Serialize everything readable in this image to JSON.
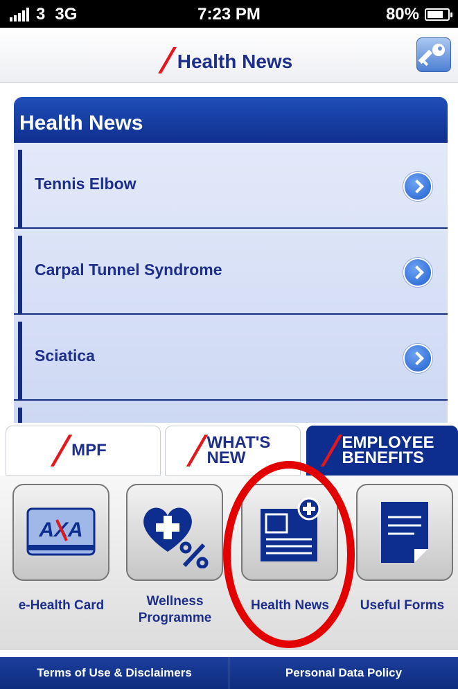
{
  "status_bar": {
    "carrier": "3",
    "network": "3G",
    "time": "7:23 PM",
    "battery": "80%",
    "battery_level": 0.8
  },
  "nav": {
    "title": "Health News"
  },
  "panel": {
    "header": "Health News",
    "items": [
      {
        "label": "Tennis Elbow"
      },
      {
        "label": "Carpal Tunnel Syndrome"
      },
      {
        "label": "Sciatica"
      }
    ]
  },
  "tabs": [
    {
      "label": "MPF"
    },
    {
      "label_line1": "WHAT'S",
      "label_line2": "NEW"
    },
    {
      "label_line1": "EMPLOYEE",
      "label_line2": "BENEFITS"
    }
  ],
  "grid": {
    "items": [
      {
        "label_line1": "e-Health Card",
        "label_line2": ""
      },
      {
        "label_line1": "Wellness",
        "label_line2": "Programme"
      },
      {
        "label_line1": "Health News",
        "label_line2": ""
      },
      {
        "label_line1": "Useful Forms",
        "label_line2": ""
      }
    ],
    "card_logo": "AXA"
  },
  "footer": {
    "terms": "Terms of Use & Disclaimers",
    "privacy": "Personal Data Policy"
  },
  "colors": {
    "brand_blue": "#1d2f8a",
    "brand_red": "#e4171d",
    "annotation_red": "#e20000"
  }
}
